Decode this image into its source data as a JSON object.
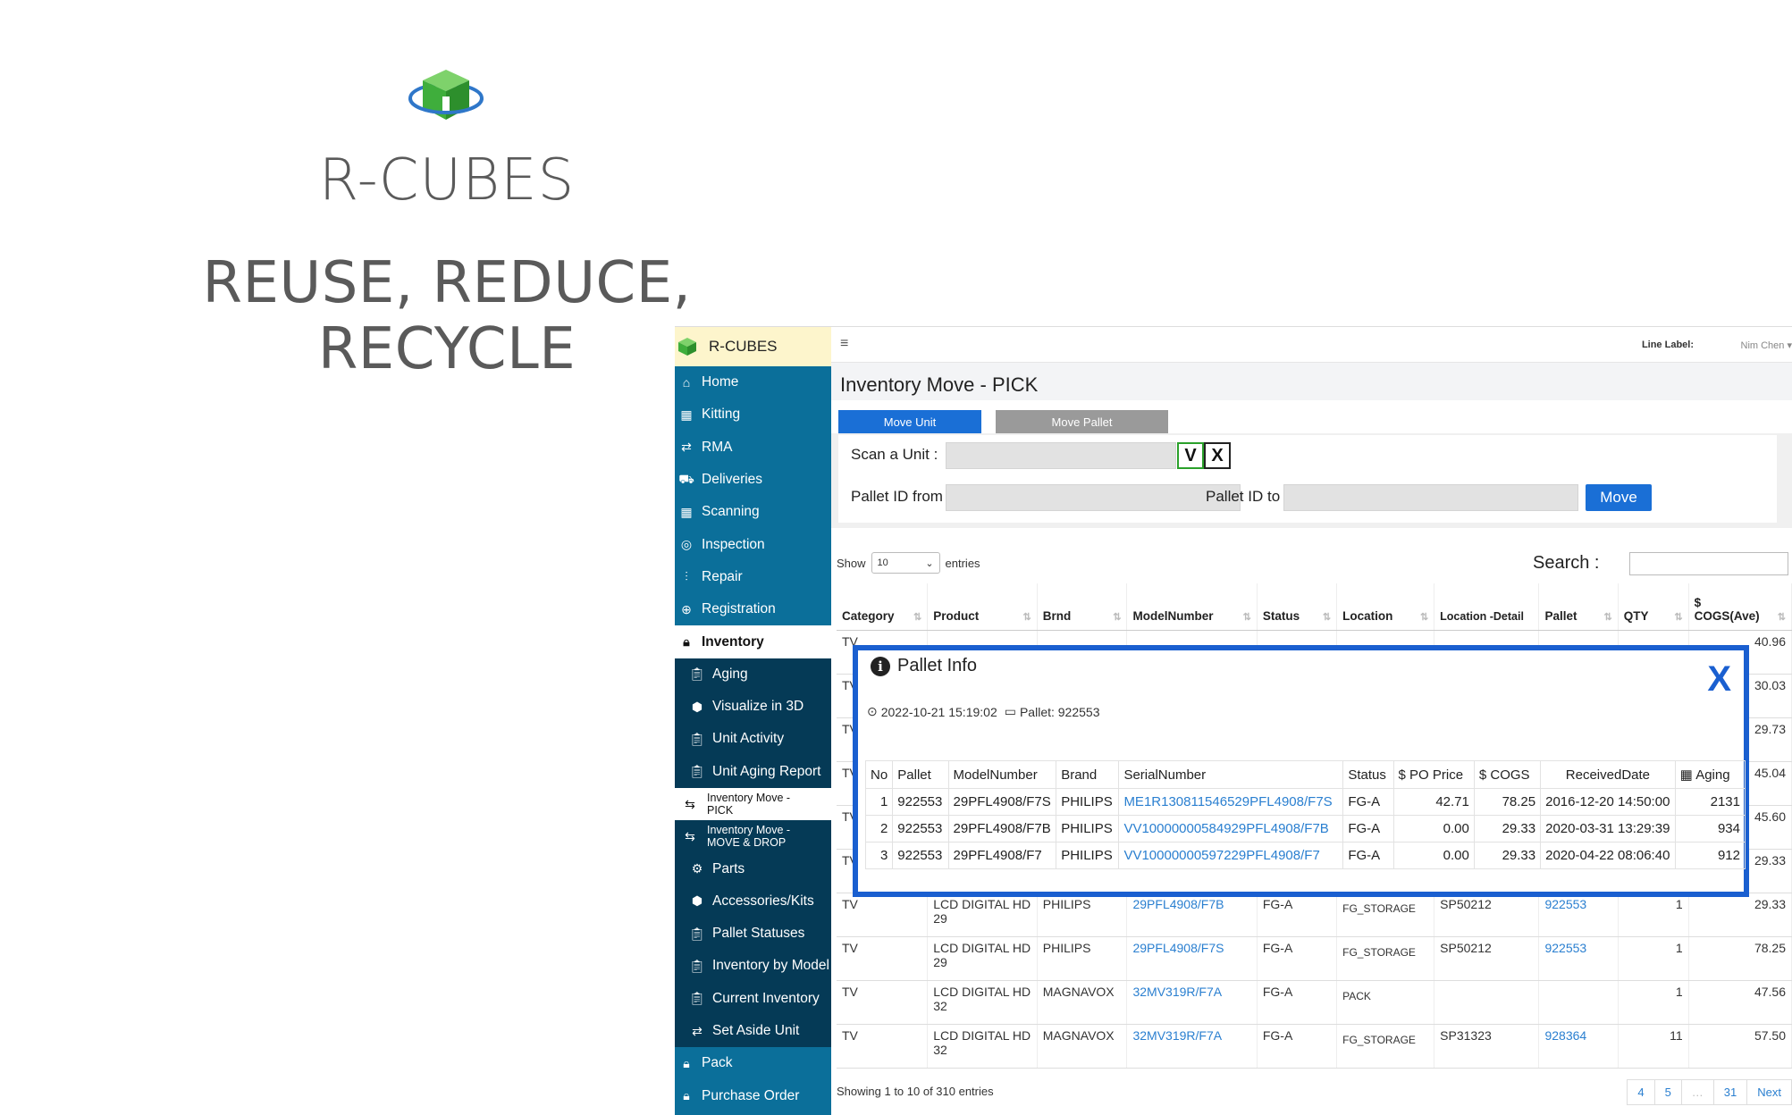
{
  "branding": {
    "title": "R-CUBES",
    "tagline": "REUSE, REDUCE, RECYCLE"
  },
  "sidebar": {
    "brand": "R-CUBES",
    "items": [
      {
        "label": "Home",
        "icon": "home-icon"
      },
      {
        "label": "Kitting",
        "icon": "grid-icon"
      },
      {
        "label": "RMA",
        "icon": "exchange-icon"
      },
      {
        "label": "Deliveries",
        "icon": "truck-icon"
      },
      {
        "label": "Scanning",
        "icon": "grid-icon"
      },
      {
        "label": "Inspection",
        "icon": "compass-icon"
      },
      {
        "label": "Repair",
        "icon": "sliders-icon"
      },
      {
        "label": "Registration",
        "icon": "plus-circle-icon"
      },
      {
        "label": "Inventory",
        "icon": "lock-icon"
      }
    ],
    "sub_items": [
      {
        "label": "Aging",
        "icon": "clipboard-icon"
      },
      {
        "label": "Visualize in 3D",
        "icon": "cube-icon"
      },
      {
        "label": "Unit Activity",
        "icon": "clipboard-icon"
      },
      {
        "label": "Unit Aging Report",
        "icon": "clipboard-icon"
      },
      {
        "label": "Inventory Move - PICK",
        "icon": "move-arrows-icon"
      },
      {
        "label": "Inventory Move -MOVE & DROP",
        "icon": "move-arrows-icon"
      },
      {
        "label": "Parts",
        "icon": "gear-icon"
      },
      {
        "label": "Accessories/Kits",
        "icon": "cubes-icon"
      },
      {
        "label": "Pallet Statuses",
        "icon": "clipboard-icon"
      },
      {
        "label": "Inventory by Model",
        "icon": "clipboard-icon"
      },
      {
        "label": "Current Inventory",
        "icon": "clipboard-icon"
      },
      {
        "label": "Set Aside Unit",
        "icon": "exchange-icon"
      }
    ],
    "bottom_items": [
      {
        "label": "Pack",
        "icon": "lock-icon"
      },
      {
        "label": "Purchase Order",
        "icon": "lock-icon"
      }
    ]
  },
  "topbar": {
    "line_label": "Line Label:",
    "user": "Nim Chen"
  },
  "page": {
    "title": "Inventory Move - PICK",
    "tabs": [
      "Move Unit",
      "Move Pallet"
    ],
    "scan_label": "Scan a Unit :",
    "v_label": "V",
    "x_label": "X",
    "pallet_from_label": "Pallet ID from :",
    "pallet_to_label": "Pallet ID to :",
    "move_button": "Move"
  },
  "table_controls": {
    "show": "Show",
    "entries_value": "10",
    "entries": "entries",
    "search_label": "Search :",
    "footer": "Showing 1 to 10 of 310 entries",
    "pager": [
      "4",
      "5",
      "…",
      "31",
      "Next"
    ]
  },
  "table": {
    "headers": [
      "Category",
      "Product",
      "Brnd",
      "ModelNumber",
      "Status",
      "Location",
      "Location -Detail",
      "Pallet",
      "QTY",
      "$ COGS(Ave)"
    ],
    "hidden_rows": [
      {
        "category": "TV",
        "cogs": "40.96"
      },
      {
        "category": "TV",
        "cogs": "30.03"
      },
      {
        "category": "TV",
        "cogs": "29.73"
      },
      {
        "category": "TV",
        "cogs": "45.04"
      },
      {
        "category": "TV",
        "cogs": "45.60"
      },
      {
        "category": "TV",
        "cogs": "29.33"
      }
    ],
    "rows": [
      {
        "category": "TV",
        "product": "LCD DIGITAL HD 29",
        "brand": "PHILIPS",
        "model": "29PFL4908/F7B",
        "status": "FG-A",
        "location": "FG_STORAGE",
        "detail": "SP50212",
        "pallet": "922553",
        "qty": "1",
        "cogs": "29.33"
      },
      {
        "category": "TV",
        "product": "LCD DIGITAL HD 29",
        "brand": "PHILIPS",
        "model": "29PFL4908/F7S",
        "status": "FG-A",
        "location": "FG_STORAGE",
        "detail": "SP50212",
        "pallet": "922553",
        "qty": "1",
        "cogs": "78.25"
      },
      {
        "category": "TV",
        "product": "LCD DIGITAL HD 32",
        "brand": "MAGNAVOX",
        "model": "32MV319R/F7A",
        "status": "FG-A",
        "location": "PACK",
        "detail": "",
        "pallet": "",
        "qty": "1",
        "cogs": "47.56"
      },
      {
        "category": "TV",
        "product": "LCD DIGITAL HD 32",
        "brand": "MAGNAVOX",
        "model": "32MV319R/F7A",
        "status": "FG-A",
        "location": "FG_STORAGE",
        "detail": "SP31323",
        "pallet": "928364",
        "qty": "11",
        "cogs": "57.50"
      }
    ]
  },
  "modal": {
    "title": "Pallet Info",
    "close": "X",
    "timestamp": "2022-10-21 15:19:02",
    "pallet_meta": "Pallet: 922553",
    "headers": [
      "No",
      "Pallet",
      "ModelNumber",
      "Brand",
      "SerialNumber",
      "Status",
      "$ PO Price",
      "$ COGS",
      "ReceivedDate",
      "Aging"
    ],
    "rows": [
      {
        "no": "1",
        "pallet": "922553",
        "model": "29PFL4908/F7S",
        "brand": "PHILIPS",
        "serial": "ME1R130811546529PFL4908/F7S",
        "status": "FG-A",
        "po": "42.71",
        "cogs": "78.25",
        "received": "2016-12-20 14:50:00",
        "aging": "2131"
      },
      {
        "no": "2",
        "pallet": "922553",
        "model": "29PFL4908/F7B",
        "brand": "PHILIPS",
        "serial": "VV10000000584929PFL4908/F7B",
        "status": "FG-A",
        "po": "0.00",
        "cogs": "29.33",
        "received": "2020-03-31 13:29:39",
        "aging": "934"
      },
      {
        "no": "3",
        "pallet": "922553",
        "model": "29PFL4908/F7",
        "brand": "PHILIPS",
        "serial": "VV10000000597229PFL4908/F7",
        "status": "FG-A",
        "po": "0.00",
        "cogs": "29.33",
        "received": "2020-04-22 08:06:40",
        "aging": "912"
      }
    ]
  },
  "colors": {
    "sidebar": "#0b6f9a",
    "sidebar_sub": "#053a56",
    "accent": "#1a6fd6",
    "brand_green": "#39b54a"
  }
}
